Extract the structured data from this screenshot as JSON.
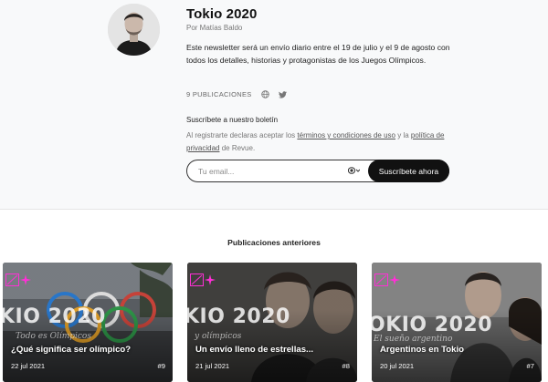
{
  "newsletter": {
    "title": "Tokio 2020",
    "author": "Por Matías Baldo",
    "description": "Este newsletter será un envío diario entre el 19 de julio y el 9 de agosto con todos los detalles, historias y protagonistas de los Juegos Olímpicos.",
    "issues_count": "9 PUBLICACIONES",
    "icons": [
      "globe-icon",
      "twitter-icon"
    ]
  },
  "subscribe": {
    "heading": "Suscríbete a nuestro boletín",
    "terms_prefix": "Al registrarte declaras aceptar los ",
    "terms_link": "términos y condiciones de uso",
    "terms_middle": " y la ",
    "privacy_link": "política de privacidad",
    "terms_suffix": " de Revue.",
    "email_placeholder": "Tu email...",
    "button_label": "Suscríbete ahora"
  },
  "previous": {
    "heading": "Publicaciones anteriores",
    "items": [
      {
        "title": "¿Qué significa ser olímpico?",
        "date": "22 jul 2021",
        "number": "#9",
        "overlay_text": "KIO 2020",
        "overlay_script": "Todo es Olímpicos"
      },
      {
        "title": "Un envío lleno de estrellas...",
        "date": "21 jul 2021",
        "number": "#8",
        "overlay_text": "KIO 2020",
        "overlay_script": "y olímpicos"
      },
      {
        "title": "Argentinos en Tokio",
        "date": "20 jul 2021",
        "number": "#7",
        "overlay_text": "OKIO 2020",
        "overlay_script": "El sueño argentino"
      }
    ]
  },
  "colors": {
    "accent": "#ff2fd6",
    "button": "#111111",
    "header_bg": "#f8f9fa"
  }
}
